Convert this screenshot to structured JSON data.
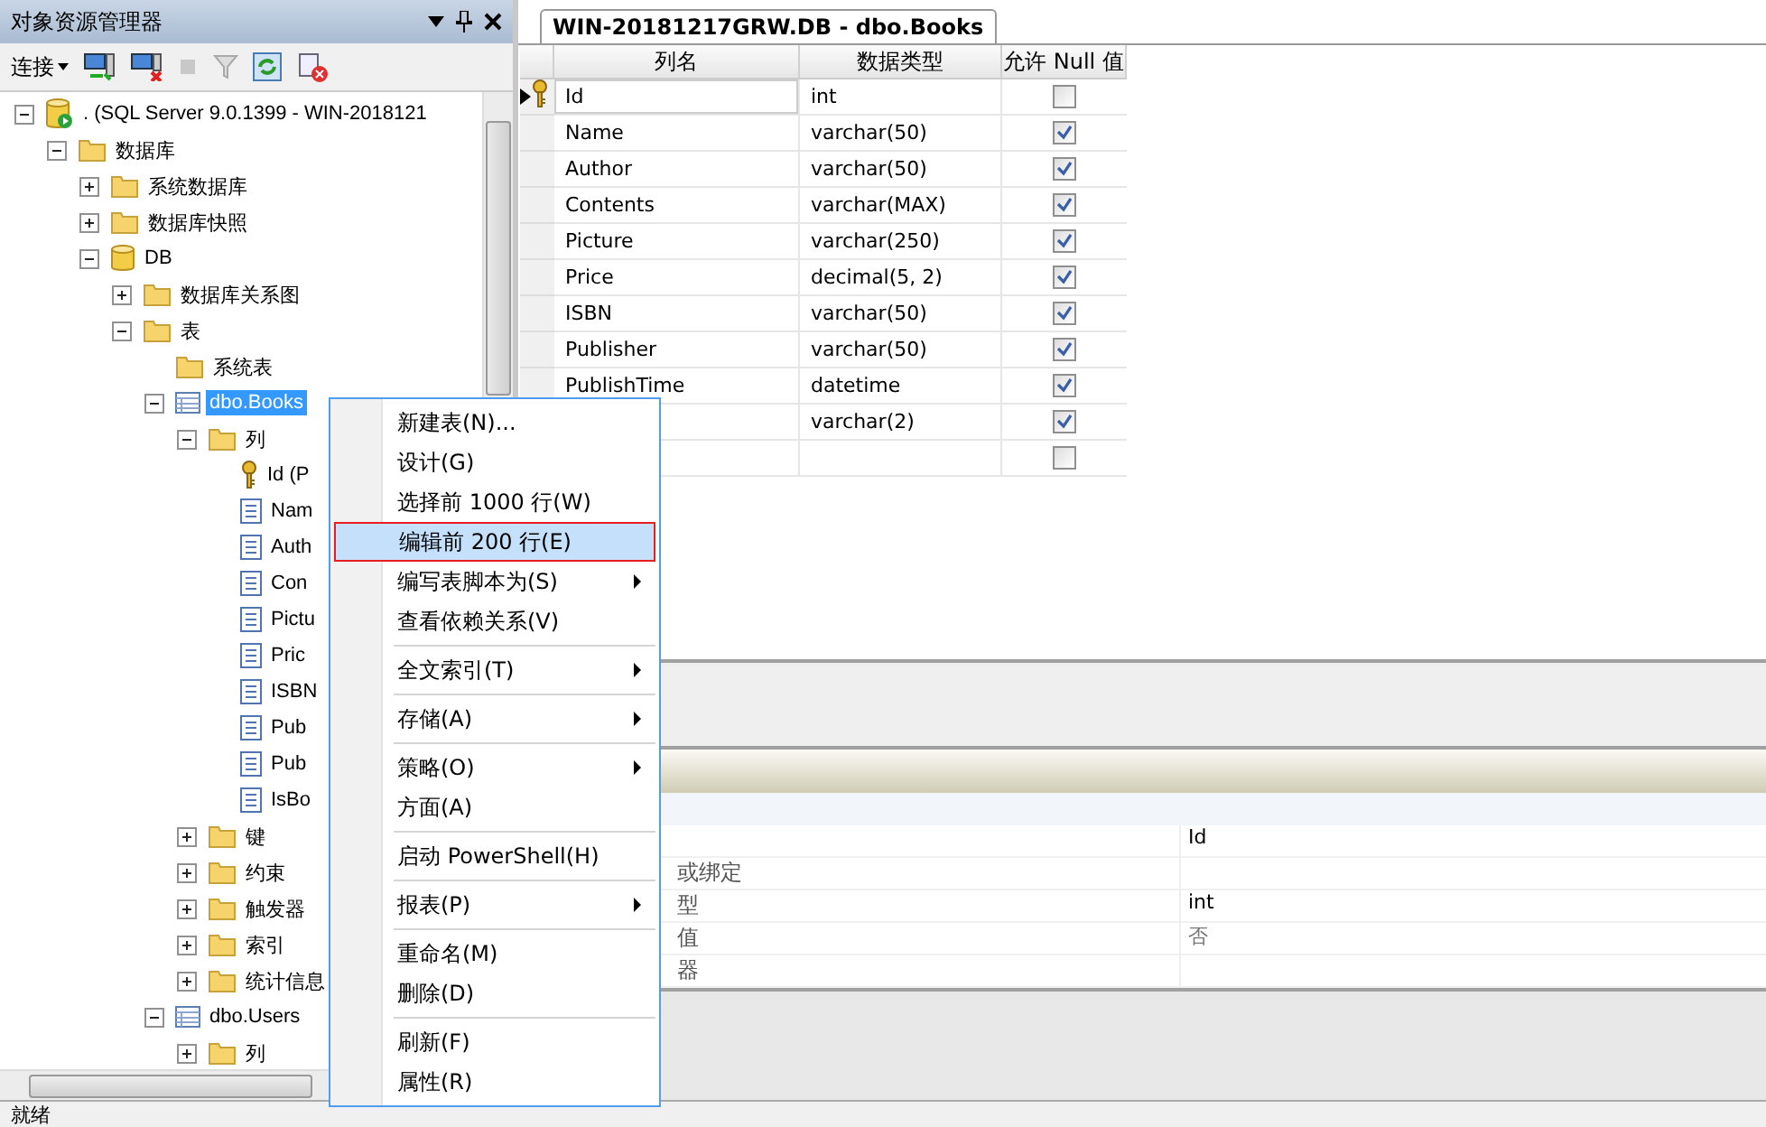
{
  "explorer": {
    "title": "对象资源管理器",
    "toolbar": {
      "connect": "连接"
    },
    "tree": [
      {
        "kind": "server",
        "label": ". (SQL Server 9.0.1399 - WIN-2018121",
        "expanded": true,
        "selected": false,
        "children": [
          {
            "kind": "folder",
            "label": "数据库",
            "expanded": true,
            "selected": false,
            "children": [
              {
                "kind": "folder",
                "label": "系统数据库",
                "expanded": false,
                "selected": false
              },
              {
                "kind": "folder",
                "label": "数据库快照",
                "expanded": false,
                "selected": false
              },
              {
                "kind": "database",
                "label": "DB",
                "expanded": true,
                "selected": false,
                "children": [
                  {
                    "kind": "folder",
                    "label": "数据库关系图",
                    "expanded": false,
                    "selected": false
                  },
                  {
                    "kind": "folder",
                    "label": "表",
                    "expanded": true,
                    "selected": false,
                    "children": [
                      {
                        "kind": "folder",
                        "label": "系统表",
                        "selected": false
                      },
                      {
                        "kind": "table",
                        "label": "dbo.Books",
                        "expanded": true,
                        "selected": true,
                        "children": [
                          {
                            "kind": "folder",
                            "label": "列",
                            "expanded": true,
                            "selected": false,
                            "children": [
                              {
                                "kind": "key",
                                "label": "Id (P",
                                "selected": false
                              },
                              {
                                "kind": "column",
                                "label": "Nam",
                                "selected": false
                              },
                              {
                                "kind": "column",
                                "label": "Auth",
                                "selected": false
                              },
                              {
                                "kind": "column",
                                "label": "Con",
                                "selected": false
                              },
                              {
                                "kind": "column",
                                "label": "Pictu",
                                "selected": false
                              },
                              {
                                "kind": "column",
                                "label": "Pric",
                                "selected": false
                              },
                              {
                                "kind": "column",
                                "label": "ISBN",
                                "selected": false
                              },
                              {
                                "kind": "column",
                                "label": "Pub",
                                "selected": false
                              },
                              {
                                "kind": "column",
                                "label": "Pub",
                                "selected": false
                              },
                              {
                                "kind": "column",
                                "label": "IsBo",
                                "selected": false
                              }
                            ]
                          },
                          {
                            "kind": "folder",
                            "label": "键",
                            "expanded": false,
                            "selected": false
                          },
                          {
                            "kind": "folder",
                            "label": "约束",
                            "expanded": false,
                            "selected": false
                          },
                          {
                            "kind": "folder",
                            "label": "触发器",
                            "expanded": false,
                            "selected": false
                          },
                          {
                            "kind": "folder",
                            "label": "索引",
                            "expanded": false,
                            "selected": false
                          },
                          {
                            "kind": "folder",
                            "label": "统计信息",
                            "expanded": false,
                            "selected": false
                          }
                        ]
                      },
                      {
                        "kind": "table",
                        "label": "dbo.Users",
                        "expanded": true,
                        "selected": false,
                        "children": [
                          {
                            "kind": "folder",
                            "label": "列",
                            "expanded": false,
                            "selected": false
                          }
                        ]
                      }
                    ]
                  }
                ]
              }
            ]
          }
        ]
      }
    ]
  },
  "document_tab": {
    "title": "WIN-20181217GRW.DB - dbo.Books"
  },
  "designer": {
    "columns": [
      "列名",
      "数据类型",
      "允许 Null 值"
    ],
    "rows": [
      {
        "name": "Id",
        "type": "int",
        "allow_null": false,
        "primary_key": true,
        "current": true
      },
      {
        "name": "Name",
        "type": "varchar(50)",
        "allow_null": true
      },
      {
        "name": "Author",
        "type": "varchar(50)",
        "allow_null": true
      },
      {
        "name": "Contents",
        "type": "varchar(MAX)",
        "allow_null": true
      },
      {
        "name": "Picture",
        "type": "varchar(250)",
        "allow_null": true
      },
      {
        "name": "Price",
        "type": "decimal(5, 2)",
        "allow_null": true
      },
      {
        "name": "ISBN",
        "type": "varchar(50)",
        "allow_null": true
      },
      {
        "name": "Publisher",
        "type": "varchar(50)",
        "allow_null": true
      },
      {
        "name": "PublishTime",
        "type": "datetime",
        "allow_null": true
      },
      {
        "type": "varchar(2)",
        "allow_null": true
      },
      {
        "allow_null": false
      }
    ]
  },
  "properties": {
    "rows": [
      {
        "value": "Id"
      },
      {
        "label": "或绑定"
      },
      {
        "label": "型",
        "value": "int"
      },
      {
        "label": "值",
        "value": "否"
      },
      {
        "label": "器"
      }
    ]
  },
  "context_menu": {
    "groups": [
      [
        {
          "label": "新建表(N)...",
          "submenu": false,
          "selected": false
        },
        {
          "label": "设计(G)",
          "submenu": false,
          "selected": false
        },
        {
          "label": "选择前 1000 行(W)",
          "submenu": false,
          "selected": false
        },
        {
          "label": "编辑前 200 行(E)",
          "submenu": false,
          "selected": true
        },
        {
          "label": "编写表脚本为(S)",
          "submenu": true,
          "selected": false
        },
        {
          "label": "查看依赖关系(V)",
          "submenu": false,
          "selected": false
        }
      ],
      [
        {
          "label": "全文索引(T)",
          "submenu": true,
          "selected": false
        }
      ],
      [
        {
          "label": "存储(A)",
          "submenu": true,
          "selected": false
        }
      ],
      [
        {
          "label": "策略(O)",
          "submenu": true,
          "selected": false
        },
        {
          "label": "方面(A)",
          "submenu": false,
          "selected": false
        }
      ],
      [
        {
          "label": "启动 PowerShell(H)",
          "submenu": false,
          "selected": false
        }
      ],
      [
        {
          "label": "报表(P)",
          "submenu": true,
          "selected": false
        }
      ],
      [
        {
          "label": "重命名(M)",
          "submenu": false,
          "selected": false
        },
        {
          "label": "删除(D)",
          "submenu": false,
          "selected": false
        }
      ],
      [
        {
          "label": "刷新(F)",
          "submenu": false,
          "selected": false
        },
        {
          "label": "属性(R)",
          "submenu": false,
          "selected": false
        }
      ]
    ]
  },
  "status_bar": {
    "text": "就绪"
  }
}
